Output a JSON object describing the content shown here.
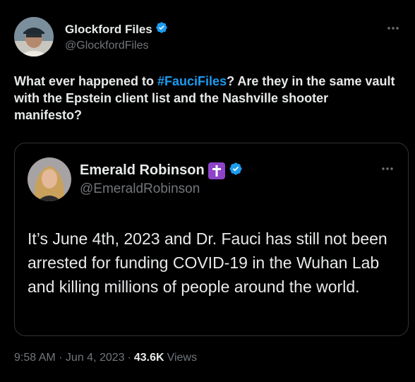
{
  "tweet": {
    "author": {
      "display_name": "Glockford Files",
      "handle": "@GlockfordFiles",
      "verified": true
    },
    "text_before": "What ever happened to ",
    "hashtag": "#FauciFiles",
    "text_after": "? Are they in the same vault with the Epstein client list and the Nashville shooter manifesto?",
    "more_icon": "more-horizontal-icon",
    "quoted": {
      "author": {
        "display_name": "Emerald Robinson",
        "handle": "@EmeraldRobinson",
        "verified": true,
        "emoji": "latin-cross-icon"
      },
      "text": "It’s June 4th, 2023 and Dr. Fauci has still not been arrested for funding COVID-19 in the Wuhan Lab and killing millions of people around the world.",
      "more_icon": "more-horizontal-icon"
    },
    "timestamp": "9:58 AM · Jun 4, 2023",
    "dot": "·",
    "views_count": "43.6K",
    "views_label": "Views"
  },
  "colors": {
    "background": "#000000",
    "text_primary": "#e7e9ea",
    "text_secondary": "#71767b",
    "accent_blue": "#1d9bf0",
    "border": "#2f3336",
    "cross_purple": "#8e44c9"
  }
}
